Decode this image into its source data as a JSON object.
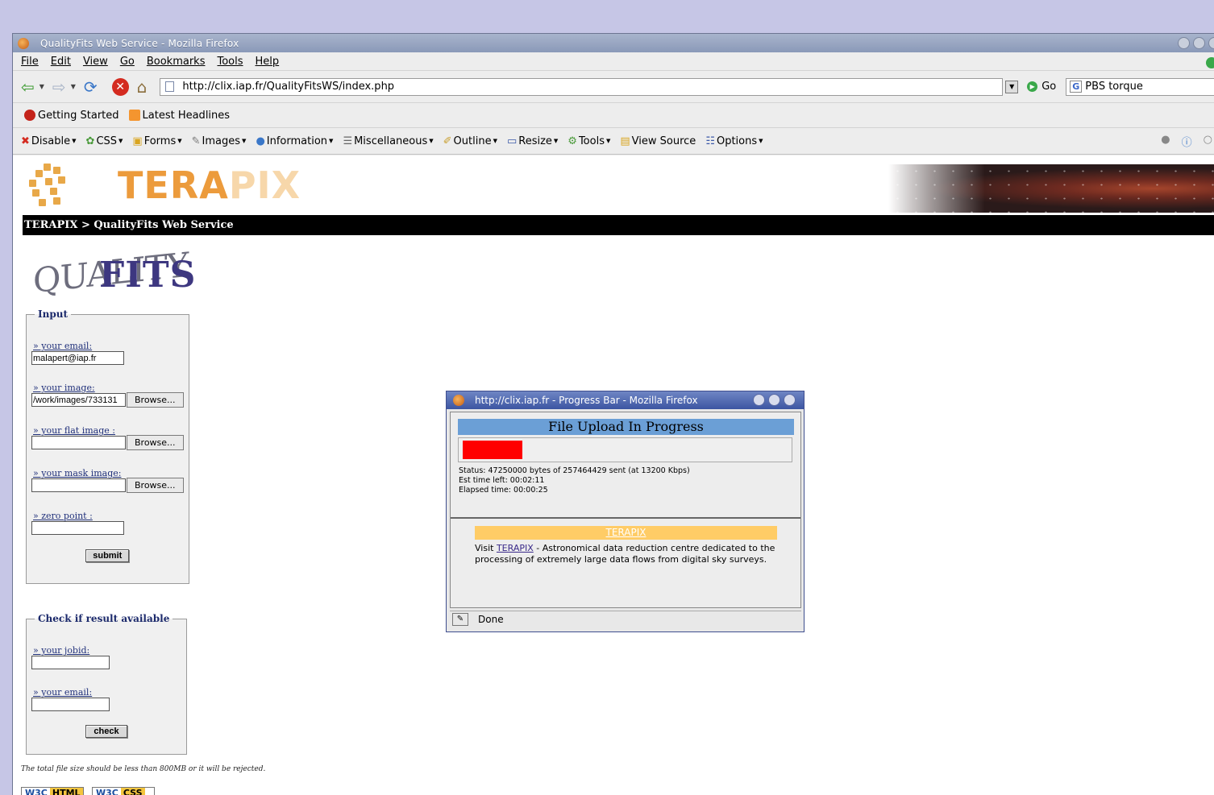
{
  "browser": {
    "title": "QualityFits Web Service - Mozilla Firefox",
    "menu": [
      "File",
      "Edit",
      "View",
      "Go",
      "Bookmarks",
      "Tools",
      "Help"
    ],
    "url": "http://clix.iap.fr/QualityFitsWS/index.php",
    "go_label": "Go",
    "search_value": "PBS torque",
    "bookmarks": [
      "Getting Started",
      "Latest Headlines"
    ],
    "dev_toolbar": [
      "Disable",
      "CSS",
      "Forms",
      "Images",
      "Information",
      "Miscellaneous",
      "Outline",
      "Resize",
      "Tools",
      "View Source",
      "Options"
    ]
  },
  "page": {
    "logo_text_main": "TERA",
    "logo_text_fade": "PIX",
    "breadcrumb": "TERAPIX > QualityFits Web Service",
    "quality_logo_a": "QUALITY",
    "quality_logo_b": "FITS",
    "input_form": {
      "legend": "Input",
      "email_label": "» your email:",
      "email_value": "malapert@iap.fr",
      "image_label": "» your image:",
      "image_value": "/work/images/733131",
      "flat_label": "» your flat image :",
      "mask_label": "» your mask image:",
      "zero_label": "» zero point :",
      "browse_label": "Browse...",
      "submit_label": "submit"
    },
    "check_form": {
      "legend": "Check if result available",
      "jobid_label": "» your jobid:",
      "email_label": "» your email:",
      "check_label": "check"
    },
    "note": "The total file size should be less than 800MB or it will be rejected.",
    "badges": [
      "W3C",
      "HTML",
      "W3C",
      "CSS"
    ]
  },
  "popup": {
    "title": "http://clix.iap.fr - Progress Bar - Mozilla Firefox",
    "header": "File Upload In Progress",
    "progress_fraction": 0.1835,
    "status_line": "Status: 47250000 bytes of 257464429 sent (at 13200 Kbps)",
    "time_left": "Est time left: 00:02:11",
    "elapsed": "Elapsed time: 00:00:25",
    "terapix_link": "TERAPIX",
    "visit_prefix": "Visit",
    "visit_link": "TERAPIX",
    "visit_suffix": "- Astronomical data reduction centre dedicated to the processing of extremely large data flows from digital sky surveys.",
    "status_bar": "Done"
  }
}
